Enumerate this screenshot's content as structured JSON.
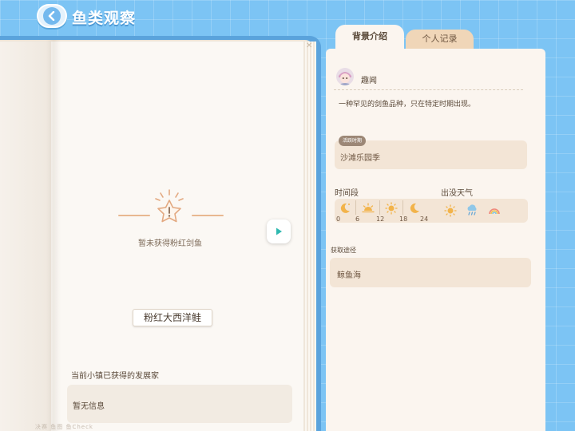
{
  "header": {
    "title": "鱼类观察"
  },
  "book": {
    "status_text": "暂未获得粉红剑鱼",
    "fish_name": "粉红大西洋鲑",
    "developers_label": "当前小镇已获得的发展家",
    "developers_value": "暂无信息",
    "faint_text": "决赛 鱼图 鱼Check"
  },
  "tabs": {
    "background": "背景介绍",
    "personal": "个人记录"
  },
  "info": {
    "fun_label": "趣闻",
    "description": "一种罕见的剑鱼品种，只在特定时期出现。",
    "active_badge": "活跃时期",
    "active_value": "沙滩乐园季",
    "time_label": "时间段",
    "weather_label": "出没天气",
    "time_icons": [
      "moon-icon",
      "sunrise-icon",
      "sun-icon",
      "sunset-icon",
      "moon-icon"
    ],
    "time_ticks": [
      "0",
      "6",
      "12",
      "18",
      "24"
    ],
    "weather_icons": [
      "sunny-icon",
      "rain-icon",
      "rainbow-icon"
    ],
    "source_label": "获取途径",
    "source_value": "鲸鱼海"
  },
  "colors": {
    "sky": "#7cc4f4",
    "paper": "#fbf8f4",
    "panel": "#fbf5ef",
    "accent": "#e8b890",
    "tab_inactive": "#f0d6b8"
  }
}
